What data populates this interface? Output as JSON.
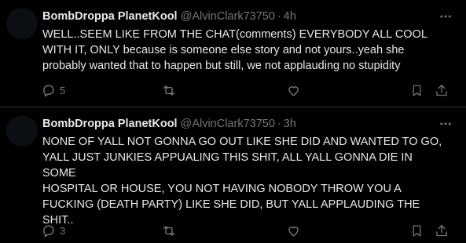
{
  "tweets": [
    {
      "display_name": "BombDroppa PlanetKool",
      "handle": "@AlvinClark73750",
      "separator": "·",
      "time": "4h",
      "text": "WELL..SEEM LIKE FROM THE CHAT(comments) EVERYBODY ALL COOL\nWITH IT, ONLY because is someone else story and not yours..yeah she\nprobably wanted that to happen but still, we not applauding no stupidity",
      "reply_count": "5"
    },
    {
      "display_name": "BombDroppa PlanetKool",
      "handle": "@AlvinClark73750",
      "separator": "·",
      "time": "3h",
      "text": "NONE OF YALL NOT GONNA GO OUT LIKE SHE DID AND WANTED TO GO,\nYALL JUST JUNKIES APPUALING THIS SHIT, ALL YALL GONNA DIE IN SOME\nHOSPITAL OR HOUSE, YOU NOT HAVING NOBODY THROW YOU A\nFUCKING (DEATH PARTY) LIKE SHE DID, BUT YALL APPLAUDING THE\nSHIT..",
      "reply_count": "3"
    }
  ],
  "icons": {
    "reply": "reply-icon",
    "retweet": "retweet-icon",
    "like": "heart-icon",
    "bookmark": "bookmark-icon",
    "share": "share-icon",
    "more": "more-icon"
  },
  "colors": {
    "background": "#000000",
    "text": "#e7e9ea",
    "muted": "#71767b",
    "divider": "#2f3336"
  }
}
